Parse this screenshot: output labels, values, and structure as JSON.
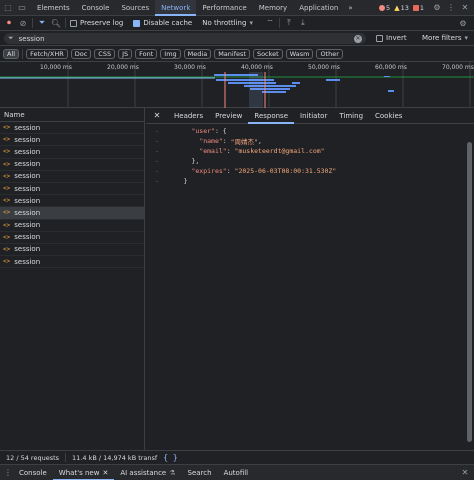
{
  "top_tabs": [
    "Elements",
    "Console",
    "Sources",
    "Network",
    "Performance",
    "Memory",
    "Application"
  ],
  "top_tabs_more": "»",
  "badges": {
    "errors": "5",
    "warnings": "13",
    "issues": "1"
  },
  "toolbar": {
    "preserve_log": "Preserve log",
    "disable_cache": "Disable cache",
    "throttling": "No throttling"
  },
  "filter": {
    "value": "session",
    "invert": "Invert",
    "more_filters": "More filters"
  },
  "type_filters": [
    "All",
    "Fetch/XHR",
    "Doc",
    "CSS",
    "JS",
    "Font",
    "Img",
    "Media",
    "Manifest",
    "Socket",
    "Wasm",
    "Other"
  ],
  "timeline": {
    "ticks": [
      "10,000 ms",
      "20,000 ms",
      "30,000 ms",
      "40,000 ms",
      "50,000 ms",
      "60,000 ms",
      "70,000 ms"
    ]
  },
  "requests": {
    "header": "Name",
    "items": [
      "session",
      "session",
      "session",
      "session",
      "session",
      "session",
      "session",
      "session",
      "session",
      "session",
      "session",
      "session"
    ],
    "selected_index": 7
  },
  "detail_tabs": [
    "Headers",
    "Preview",
    "Response",
    "Initiator",
    "Timing",
    "Cookies"
  ],
  "detail_active": "Response",
  "response": {
    "user_key": "\"user\"",
    "name_key": "\"name\"",
    "name_val": "\"周婧杰\"",
    "email_key": "\"email\"",
    "email_val": "\"musketeerdt@gmail.com\"",
    "expires_key": "\"expires\"",
    "expires_val": "\"2025-06-03T08:00:31.530Z\""
  },
  "status": {
    "requests": "12 / 54 requests",
    "transferred": "11.4 kB / 14,974 kB transf"
  },
  "drawer_tabs": [
    "Console",
    "What's new",
    "AI assistance",
    "Search",
    "Autofill"
  ],
  "colors": {
    "accent": "#8ab4f8",
    "error": "#f28b82",
    "warning": "#fdd663",
    "issue": "#ee675c"
  }
}
